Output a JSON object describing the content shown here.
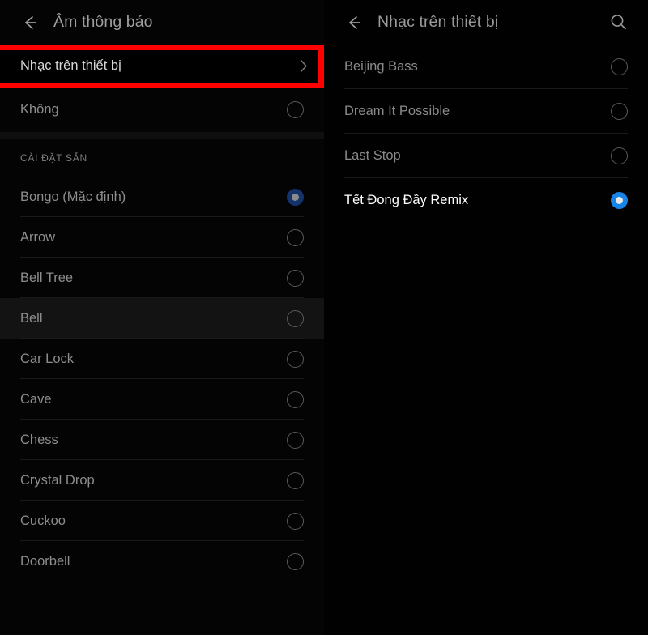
{
  "left_panel": {
    "appbar": {
      "title": "Âm thông báo",
      "back_icon": "arrow-left-icon"
    },
    "nav_row": {
      "label": "Nhạc trên thiết bị",
      "chevron_icon": "chevron-right-icon"
    },
    "none_row": {
      "label": "Không",
      "selected": false
    },
    "section_header": "CÀI ĐẶT SẴN",
    "items": [
      {
        "label": "Bongo (Mặc định)",
        "selected": true,
        "pressed": false
      },
      {
        "label": "Arrow",
        "selected": false,
        "pressed": false
      },
      {
        "label": "Bell Tree",
        "selected": false,
        "pressed": false
      },
      {
        "label": "Bell",
        "selected": false,
        "pressed": true
      },
      {
        "label": "Car Lock",
        "selected": false,
        "pressed": false
      },
      {
        "label": "Cave",
        "selected": false,
        "pressed": false
      },
      {
        "label": "Chess",
        "selected": false,
        "pressed": false
      },
      {
        "label": "Crystal Drop",
        "selected": false,
        "pressed": false
      },
      {
        "label": "Cuckoo",
        "selected": false,
        "pressed": false
      },
      {
        "label": "Doorbell",
        "selected": false,
        "pressed": false
      }
    ]
  },
  "right_panel": {
    "appbar": {
      "title": "Nhạc trên thiết bị",
      "back_icon": "arrow-left-icon",
      "search_icon": "search-icon"
    },
    "items": [
      {
        "label": "Beijing Bass",
        "selected": false
      },
      {
        "label": "Dream It Possible",
        "selected": false
      },
      {
        "label": "Last Stop",
        "selected": false
      },
      {
        "label": "Tết Đong Đầy Remix",
        "selected": true
      }
    ]
  },
  "annotations": {
    "highlight_color": "#ff0000",
    "boxes": [
      {
        "name": "highlight-nhac-tren-thiet-bi"
      },
      {
        "name": "highlight-tet-dong-day-remix"
      }
    ]
  },
  "theme": {
    "background": "#000000",
    "text_primary": "#ffffff",
    "text_secondary": "#8d8d8d",
    "accent_selected": "#1784e8",
    "accent_selected_dim": "#15336b"
  }
}
